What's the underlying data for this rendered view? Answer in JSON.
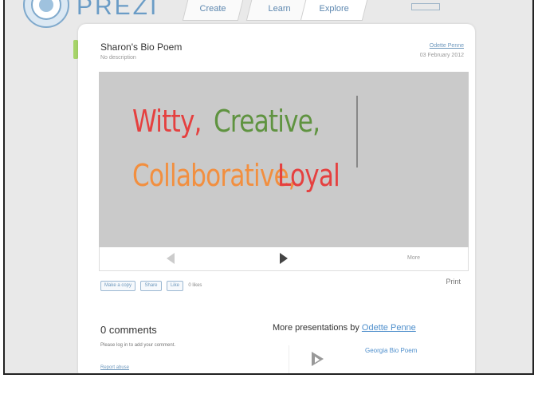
{
  "brand": {
    "name": "PREZI"
  },
  "nav": {
    "tabs": [
      {
        "label": "Create"
      },
      {
        "label": "Learn"
      },
      {
        "label": "Explore"
      }
    ]
  },
  "presentation": {
    "title": "Sharon's Bio Poem",
    "description": "No description",
    "author_link": "Odette Penne",
    "date": "03 February 2012",
    "slide_words": [
      {
        "text": "Witty,",
        "color": "#e5403f"
      },
      {
        "text": "Creative,",
        "color": "#5f9340"
      },
      {
        "text": "Collaborative,",
        "color": "#f28f3f"
      },
      {
        "text": "Loyal",
        "color": "#e5403f"
      }
    ],
    "more_label": "More"
  },
  "actions": {
    "copy_label": "Make a copy",
    "share_label": "Share",
    "like_label": "Like",
    "likes_count": "0 likes",
    "print_label": "Print"
  },
  "comments": {
    "title": "0 comments",
    "note": "Please log in to add your comment.",
    "report_link": "Report abuse"
  },
  "more_presentations": {
    "prefix": "More presentations by",
    "author": "Odette Penne",
    "item_title": "Georgia Bio Poem"
  },
  "colors": {
    "accent": "#4f8fcc",
    "green_marker": "#a6d469"
  }
}
